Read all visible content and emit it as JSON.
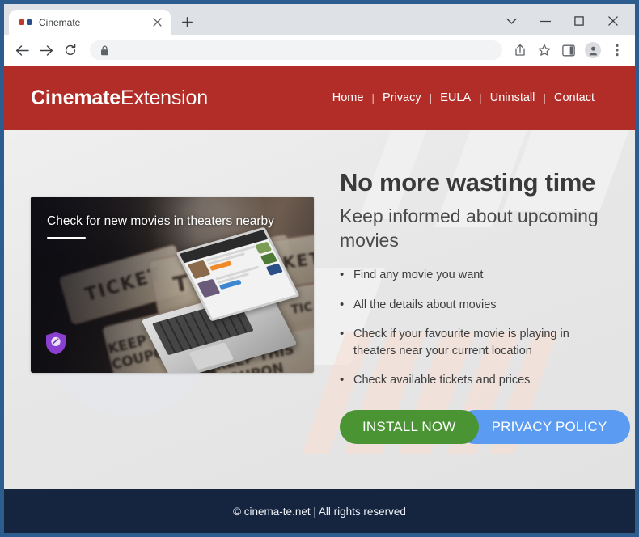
{
  "browser": {
    "tab": {
      "title": "Cinemate",
      "favicon": "glasses-icon",
      "close_icon": "✕"
    },
    "new_tab_icon": "+",
    "window_controls": {
      "more": "⌄",
      "minimize": "—",
      "maximize": "▢",
      "close": "✕"
    },
    "toolbar": {
      "back_icon": "←",
      "forward_icon": "→",
      "reload_icon": "⟳",
      "lock_icon": "lock-icon",
      "address_value": "",
      "address_placeholder": "",
      "share_icon": "share-icon",
      "bookmark_icon": "star-icon",
      "side_panel_icon": "side-panel-icon",
      "profile_icon": "profile-avatar-icon",
      "menu_icon": "⋮"
    }
  },
  "site": {
    "brand": {
      "bold": "Cinemate",
      "light": "Extension"
    },
    "nav": [
      {
        "label": "Home"
      },
      {
        "label": "Privacy"
      },
      {
        "label": "EULA"
      },
      {
        "label": "Uninstall"
      },
      {
        "label": "Contact"
      }
    ],
    "nav_separator": "|",
    "hero": {
      "heading": "No more wasting time",
      "subheading": "Keep informed about upcoming movies",
      "features": [
        "Find any movie you want",
        "All the details about movies",
        "Check if your favourite movie is playing in theaters near your current location",
        "Check available tickets and prices"
      ],
      "buttons": {
        "install": "INSTALL NOW",
        "privacy": "PRIVACY POLICY"
      },
      "screenshot": {
        "caption": "Check for new movies in theaters nearby",
        "ticket_words": {
          "a": "TICKET",
          "b": "TICKET",
          "c": "TICKET",
          "d": "KEEP THIS COUPON",
          "e": "KEEP THIS COUPON",
          "f": "TIC"
        },
        "badge": "shield-badge-icon"
      }
    },
    "footer": {
      "text": "© cinema-te.net | All rights reserved"
    }
  },
  "colors": {
    "header_red": "#b32d28",
    "footer_navy": "#15253f",
    "install_green": "#4a9434",
    "privacy_blue": "#5b9bf2",
    "window_frame_blue": "#2d5c8f",
    "page_bg": "#e9e9e9"
  }
}
